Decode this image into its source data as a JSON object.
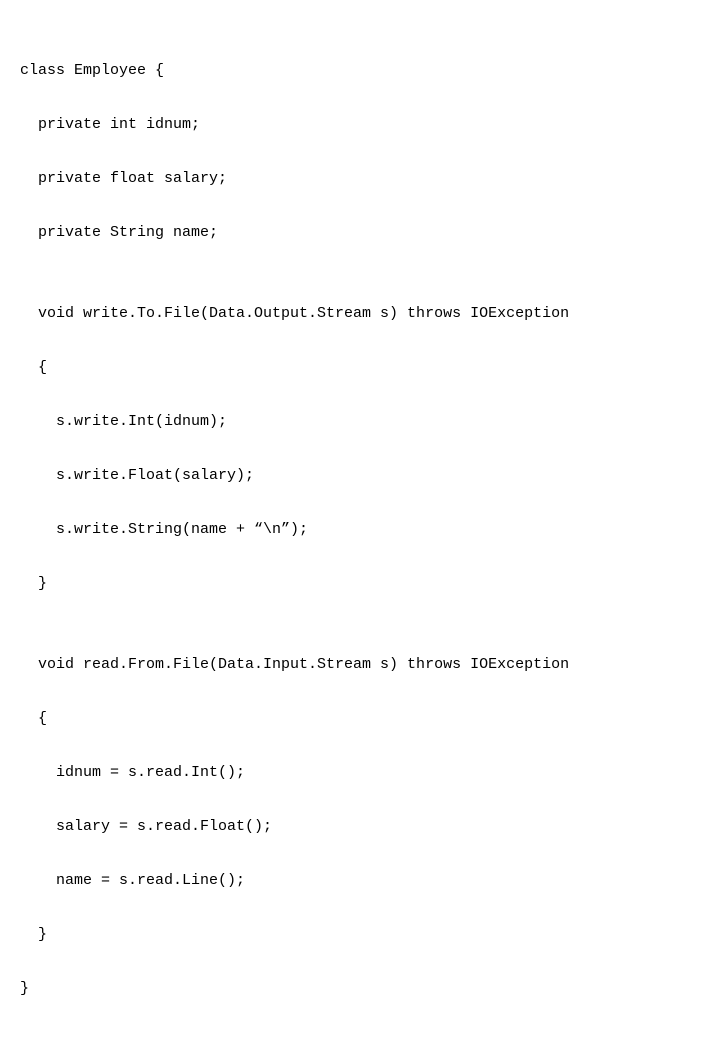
{
  "code": {
    "l1": "class Employee {",
    "l2": "private int idnum;",
    "l3": "private float salary;",
    "l4": "private String name;",
    "l5": "",
    "l6": "void write.To.File(Data.Output.Stream s) throws IOException",
    "l7": "{",
    "l8": "s.write.Int(idnum);",
    "l9": "s.write.Float(salary);",
    "l10": "s.write.String(name + “\\n”);",
    "l11": "}",
    "l12": "",
    "l13": "void read.From.File(Data.Input.Stream s) throws IOException",
    "l14": "{",
    "l15": "idnum = s.read.Int();",
    "l16": "salary = s.read.Float();",
    "l17": "name = s.read.Line();",
    "l18": "}",
    "l19": "}"
  }
}
